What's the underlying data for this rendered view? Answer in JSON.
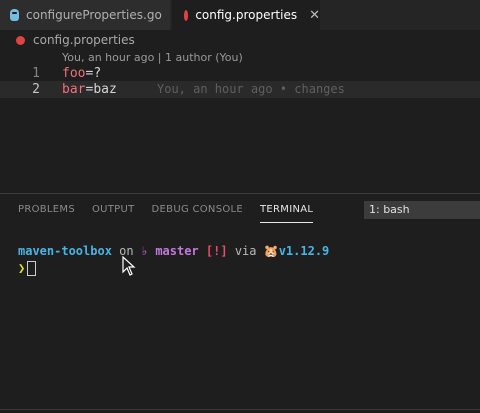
{
  "tabs": [
    {
      "label": "configureProperties.go",
      "icon": "go-gopher-icon"
    },
    {
      "label": "config.properties",
      "icon": "properties-file-icon",
      "close": "✕"
    }
  ],
  "breadcrumb": {
    "file": "config.properties"
  },
  "editor": {
    "codelens": "You, an hour ago | 1 author (You)",
    "lines": [
      {
        "number": "1",
        "key": "foo",
        "eq": "=",
        "value": "?"
      },
      {
        "number": "2",
        "key": "bar",
        "eq": "=",
        "value": "baz",
        "blame": "You, an hour ago • changes"
      }
    ]
  },
  "panel": {
    "tabs": [
      "PROBLEMS",
      "OUTPUT",
      "DEBUG CONSOLE",
      "TERMINAL"
    ],
    "active_tab": "TERMINAL",
    "terminal_select": "1: bash"
  },
  "terminal": {
    "dir": "maven-toolbox",
    "on": "on",
    "branch_icon": "♭",
    "branch": "master",
    "status": "[!]",
    "via": "via",
    "go_icon": "🐹",
    "version": "v1.12.9",
    "prompt": "❯"
  },
  "colors": {
    "background": "#1e1e1e",
    "tab_bar": "#252526",
    "key": "#f07178",
    "dir": "#47b4e6",
    "branch": "#c678dd",
    "status": "#e24f6a",
    "prompt": "#e5e510"
  }
}
